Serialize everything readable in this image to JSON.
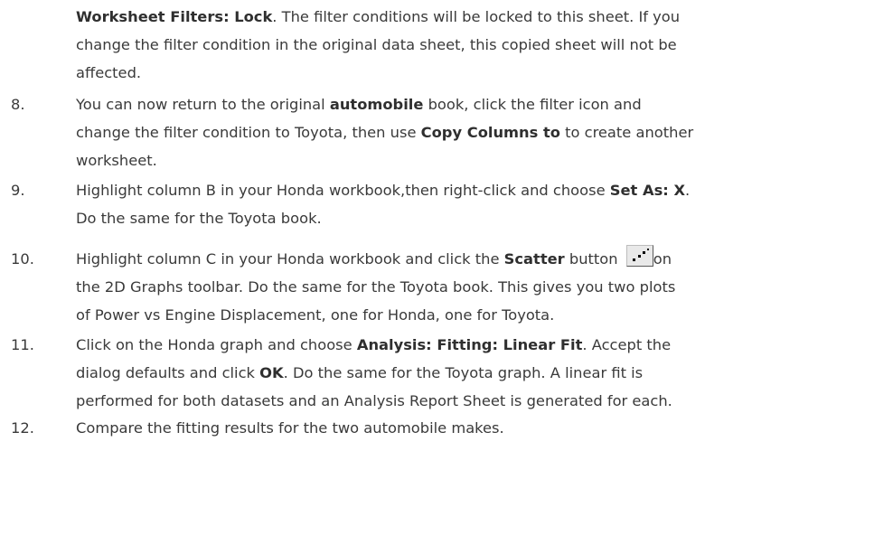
{
  "intro": {
    "lead_bold": "Worksheet Filters: Lock",
    "text_line1": ". The filter conditions will be locked to this sheet. If you",
    "text_line2": "change the filter condition in the original data sheet, this copied sheet will not be",
    "text_line3": "affected."
  },
  "steps": [
    {
      "number": "8.",
      "line1_a": "You can now return to the original ",
      "line1_b": "automobile",
      "line1_c": " book, click the filter icon and",
      "line2_a": "change the filter condition to Toyota, then use ",
      "line2_b": "Copy Columns to",
      "line2_c": " to create another",
      "line3": "worksheet."
    },
    {
      "number": "9.",
      "line1_a": "Highlight column B in your Honda workbook,then right-click and choose ",
      "line1_b": "Set As: X",
      "line1_c": ".",
      "line2": "Do the same for the Toyota book."
    },
    {
      "number": "10.",
      "line1_a": "Highlight column C in your Honda workbook and click the ",
      "line1_b": "Scatter",
      "line1_c": " button ",
      "line1_d": "on",
      "button_icon": "scatter-plot-icon",
      "line2": "the 2D Graphs toolbar. Do the same for the Toyota book. This gives you two plots",
      "line3": "of Power vs Engine Displacement, one for Honda, one for Toyota."
    },
    {
      "number": "11.",
      "line1_a": "Click on the Honda graph and choose ",
      "line1_b": "Analysis: Fitting: Linear Fit",
      "line1_c": ". Accept the",
      "line2_a": "dialog defaults and click ",
      "line2_b": "OK",
      "line2_c": ". Do the same for the Toyota graph. A linear fit is",
      "line3": "performed for both datasets and an Analysis Report Sheet is generated for each."
    },
    {
      "number": "12.",
      "line1": "Compare the fitting results for the two automobile makes."
    }
  ],
  "colors": {
    "text": "#3a3a3a",
    "button_face": "#e9e9e9"
  }
}
